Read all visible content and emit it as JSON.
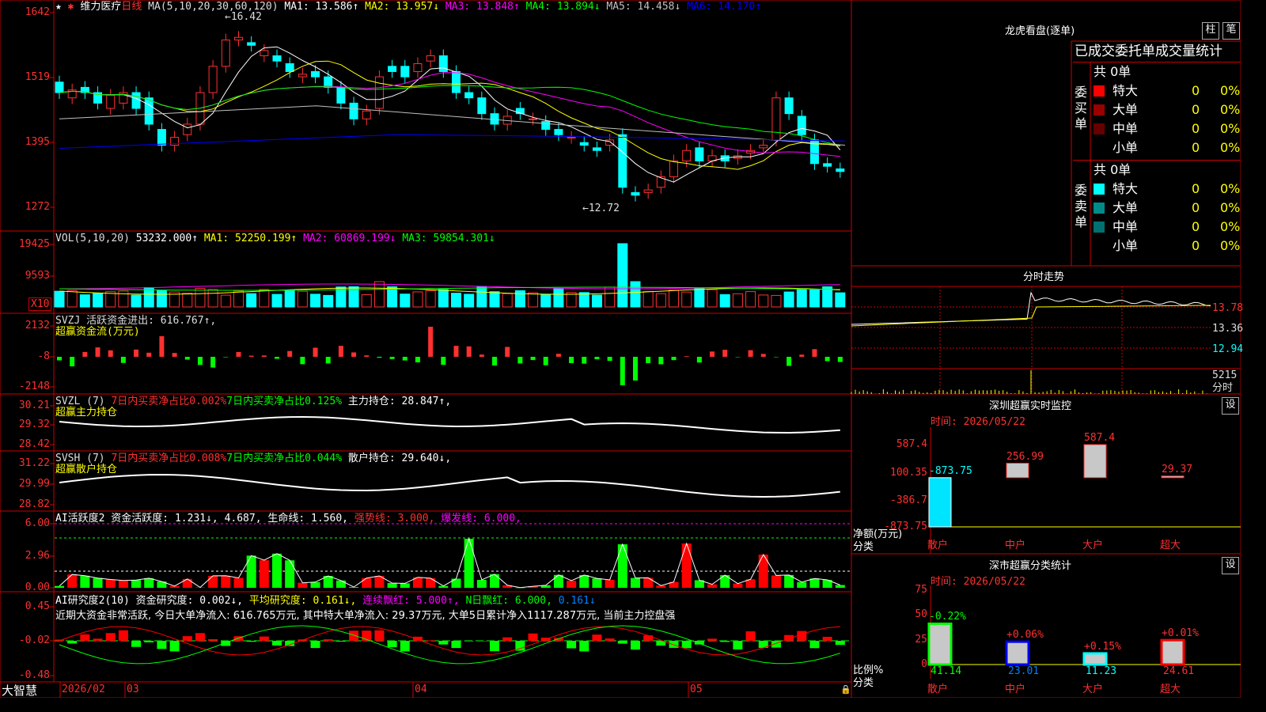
{
  "app": {
    "brand": "大智慧"
  },
  "main_chart": {
    "symbol": "维力医疗",
    "period": "日线",
    "indicator_label": "MA(5,10,20,30,60,120)",
    "ma": [
      {
        "label": "MA1: 13.586↑",
        "color": "#ffffff"
      },
      {
        "label": "MA2: 13.957↓",
        "color": "#ffff00"
      },
      {
        "label": "MA3: 13.848↑",
        "color": "#ff00ff"
      },
      {
        "label": "MA4: 13.894↓",
        "color": "#00ff00"
      },
      {
        "label": "MA5: 14.458↓",
        "color": "#c0c0c0"
      },
      {
        "label": "MA6: 14.170↑",
        "color": "#0000ff"
      }
    ],
    "y_ticks": [
      "1642",
      "1519",
      "1395",
      "1272"
    ],
    "high_label": "←16.42",
    "low_label": "←12.72",
    "x_ticks": [
      "2026/02",
      "03",
      "04",
      "05"
    ]
  },
  "volume": {
    "label": "VOL(5,10,20)",
    "value": "53232.000↑",
    "ma": [
      {
        "label": "MA1: 52250.199↑",
        "color": "#ffff00"
      },
      {
        "label": "MA2: 60869.199↓",
        "color": "#ff00ff"
      },
      {
        "label": "MA3: 59854.301↓",
        "color": "#00ff00"
      }
    ],
    "y_ticks": [
      "19425",
      "9593"
    ],
    "unit": "X10"
  },
  "svzj": {
    "label": "SVZJ  活跃资金进出: 616.767↑,",
    "subtitle": "超赢资金流(万元)",
    "y_ticks": [
      "2132",
      "-8",
      "-2148"
    ]
  },
  "svzl": {
    "label": "SVZL (7)",
    "part1": "7日内买卖净占比0.002%",
    "part2": "7日内买卖净占比0.125%",
    "part3": "主力持仓: 28.847↑,",
    "subtitle": "超赢主力持仓",
    "y_ticks": [
      "30.21",
      "29.32",
      "28.42"
    ]
  },
  "svsh": {
    "label": "SVSH (7)",
    "part1": "7日内买卖净占比0.008%",
    "part2": "7日内买卖净占比0.044%",
    "part3": "散户持仓: 29.640↓,",
    "subtitle": "超赢散户持仓",
    "y_ticks": [
      "31.22",
      "29.99",
      "28.82"
    ]
  },
  "ai_active": {
    "label": "AI活跃度2 资金活跃度: 1.231↓, 4.687, 生命线: 1.560,",
    "strong": "强势线: 3.000,",
    "burst": "爆发线: 6.000,",
    "y_ticks": [
      "6.00",
      "2.96",
      "0.00"
    ]
  },
  "ai_research": {
    "label": "AI研究度2(10) 资金研究度: 0.002↓,",
    "avg": "平均研究度: 0.161↓,",
    "red": "连续飘红: 5.000↑,",
    "nred": "N日飘红: 6.000,",
    "val": "0.161↓",
    "summary": "近期大资金非常活跃, 今日大单净流入: 616.765万元, 其中特大单净流入: 29.37万元, 大单5日累计净入1117.287万元, 当前主力控盘强",
    "y_ticks": [
      "0.45",
      "-0.02",
      "-0.48"
    ]
  },
  "dragon_tiger": {
    "title": "龙虎看盘(逐单)",
    "btn_bar": "柱",
    "btn_pen": "笔",
    "header": "已成交委托单成交量统计",
    "buy": {
      "side_label": "委买单",
      "total": "共 0单",
      "rows": [
        {
          "name": "特大",
          "count": "0",
          "pct": "0%",
          "color": "#ff0000"
        },
        {
          "name": "大单",
          "count": "0",
          "pct": "0%",
          "color": "#990000"
        },
        {
          "name": "中单",
          "count": "0",
          "pct": "0%",
          "color": "#660000"
        },
        {
          "name": "小单",
          "count": "0",
          "pct": "0%",
          "color": "#000000"
        }
      ]
    },
    "sell": {
      "side_label": "委卖单",
      "total": "共 0单",
      "rows": [
        {
          "name": "特大",
          "count": "0",
          "pct": "0%",
          "color": "#00ffff"
        },
        {
          "name": "大单",
          "count": "0",
          "pct": "0%",
          "color": "#008b8b"
        },
        {
          "name": "中单",
          "count": "0",
          "pct": "0%",
          "color": "#007070"
        },
        {
          "name": "小单",
          "count": "0",
          "pct": "0%",
          "color": "#000000"
        }
      ]
    }
  },
  "intraday": {
    "title": "分时走势",
    "ticks": [
      "13.78",
      "13.36",
      "12.94",
      "5215"
    ],
    "fenshi": "分时"
  },
  "sz_monitor": {
    "title": "深圳超赢实时监控",
    "btn": "设",
    "time": "时间: 2026/05/22",
    "y_ticks": [
      "587.4",
      "100.35",
      "-386.7",
      "-873.75"
    ],
    "ylabel": "净额(万元)",
    "xlabel": "分类",
    "chart_data": {
      "type": "bar",
      "categories": [
        "散户",
        "中户",
        "大户",
        "超大"
      ],
      "values": [
        -873.75,
        256.99,
        587.4,
        29.37
      ],
      "value_labels": [
        "-873.75",
        "256.99",
        "587.4",
        "29.37"
      ],
      "ylim": [
        -873.75,
        587.4
      ]
    }
  },
  "sz_class": {
    "title": "深市超赢分类统计",
    "btn": "设",
    "time": "时间: 2026/05/22",
    "y_ticks": [
      "75",
      "50",
      "25",
      "0"
    ],
    "ylabel": "比例%",
    "xlabel": "分类",
    "chart_data": {
      "type": "bar",
      "categories": [
        "散户",
        "中户",
        "大户",
        "超大"
      ],
      "values": [
        41.14,
        23.01,
        11.23,
        24.61
      ],
      "changes": [
        "-0.22%",
        "+0.06%",
        "+0.15%",
        "+0.01%"
      ],
      "ylim": [
        0,
        75
      ]
    }
  }
}
